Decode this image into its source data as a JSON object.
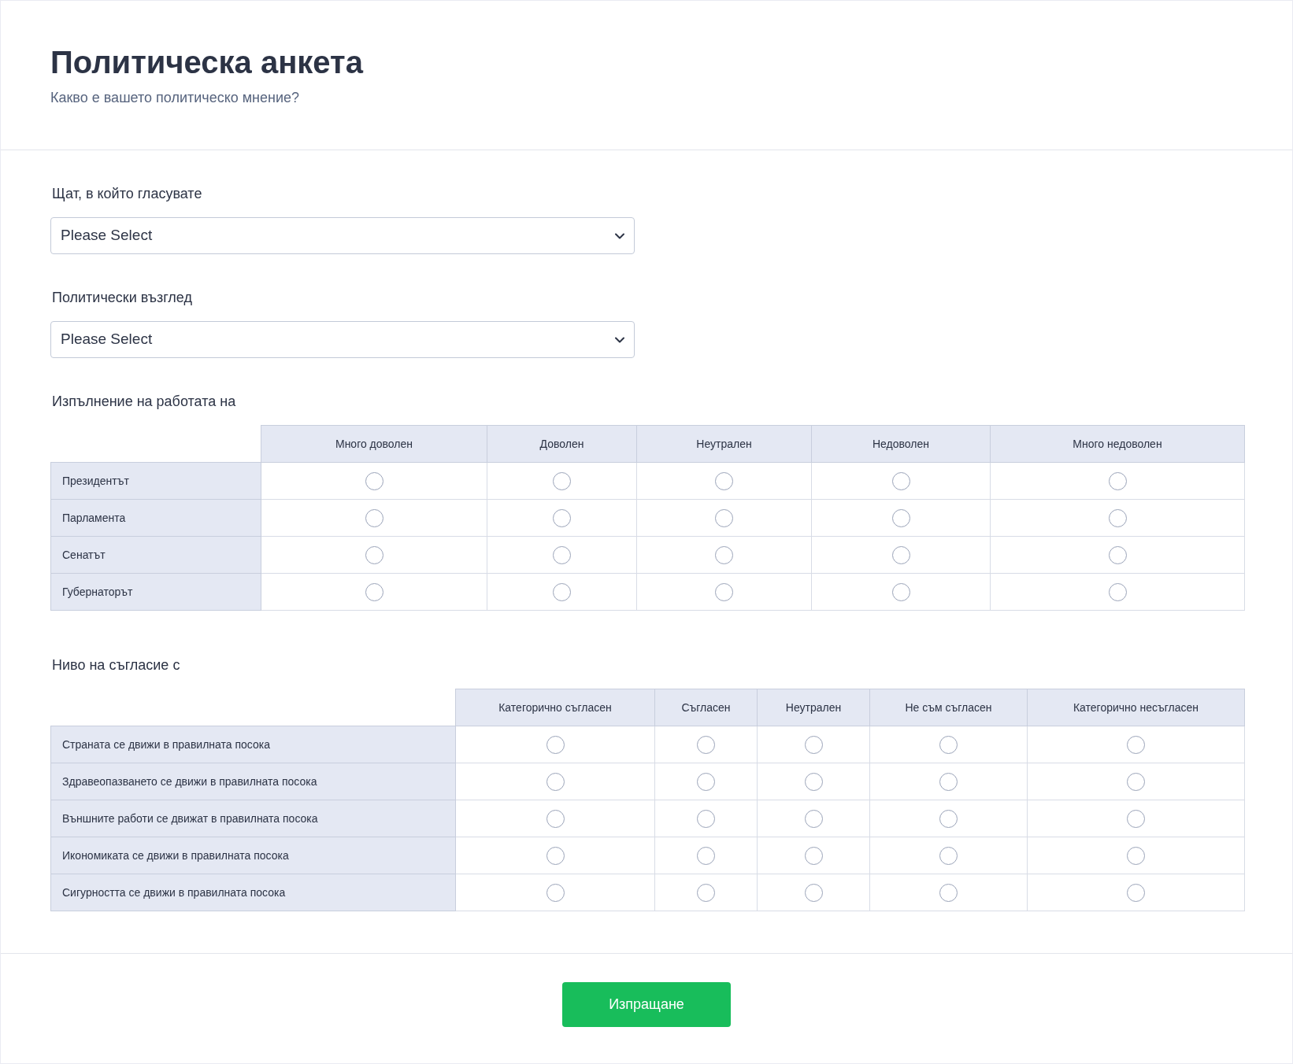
{
  "header": {
    "title": "Политическа анкета",
    "subtitle": "Какво е вашето политическо мнение?"
  },
  "dropdowns": [
    {
      "label": "Щат, в който гласувате",
      "placeholder": "Please Select"
    },
    {
      "label": "Политически възглед",
      "placeholder": "Please Select"
    }
  ],
  "matrices": [
    {
      "label": "Изпълнение на работата на",
      "columns": [
        "Много доволен",
        "Доволен",
        "Неутрален",
        "Недоволен",
        "Много недоволен"
      ],
      "rows": [
        {
          "label": "Президентът",
          "options": [
            {
              "selected": false
            },
            {
              "selected": false
            },
            {
              "selected": false
            },
            {
              "selected": false
            },
            {
              "selected": false
            }
          ]
        },
        {
          "label": "Парламента",
          "options": [
            {
              "selected": false
            },
            {
              "selected": false
            },
            {
              "selected": false
            },
            {
              "selected": false
            },
            {
              "selected": false
            }
          ]
        },
        {
          "label": "Сенатът",
          "options": [
            {
              "selected": false
            },
            {
              "selected": false
            },
            {
              "selected": false
            },
            {
              "selected": false
            },
            {
              "selected": false
            }
          ]
        },
        {
          "label": "Губернаторът",
          "options": [
            {
              "selected": false
            },
            {
              "selected": false
            },
            {
              "selected": false
            },
            {
              "selected": false
            },
            {
              "selected": false
            }
          ]
        }
      ]
    },
    {
      "label": "Ниво на съгласие с",
      "columns": [
        "Категорично съгласен",
        "Съгласен",
        "Неутрален",
        "Не съм съгласен",
        "Категорично несъгласен"
      ],
      "rows": [
        {
          "label": "Страната се движи в правилната посока",
          "options": [
            {
              "selected": false
            },
            {
              "selected": false
            },
            {
              "selected": false
            },
            {
              "selected": false
            },
            {
              "selected": false
            }
          ]
        },
        {
          "label": "Здравеопазването се движи в правилната посока",
          "options": [
            {
              "selected": false
            },
            {
              "selected": false
            },
            {
              "selected": false
            },
            {
              "selected": false
            },
            {
              "selected": false
            }
          ]
        },
        {
          "label": "Външните работи се движат в правилната посока",
          "options": [
            {
              "selected": false
            },
            {
              "selected": false
            },
            {
              "selected": false
            },
            {
              "selected": false
            },
            {
              "selected": false
            }
          ]
        },
        {
          "label": "Икономиката се движи в правилната посока",
          "options": [
            {
              "selected": false
            },
            {
              "selected": false
            },
            {
              "selected": false
            },
            {
              "selected": false
            },
            {
              "selected": false
            }
          ]
        },
        {
          "label": "Сигурността се движи в правилната посока",
          "options": [
            {
              "selected": false
            },
            {
              "selected": false
            },
            {
              "selected": false
            },
            {
              "selected": false
            },
            {
              "selected": false
            }
          ]
        }
      ]
    }
  ],
  "submit": {
    "label": "Изпращане"
  }
}
